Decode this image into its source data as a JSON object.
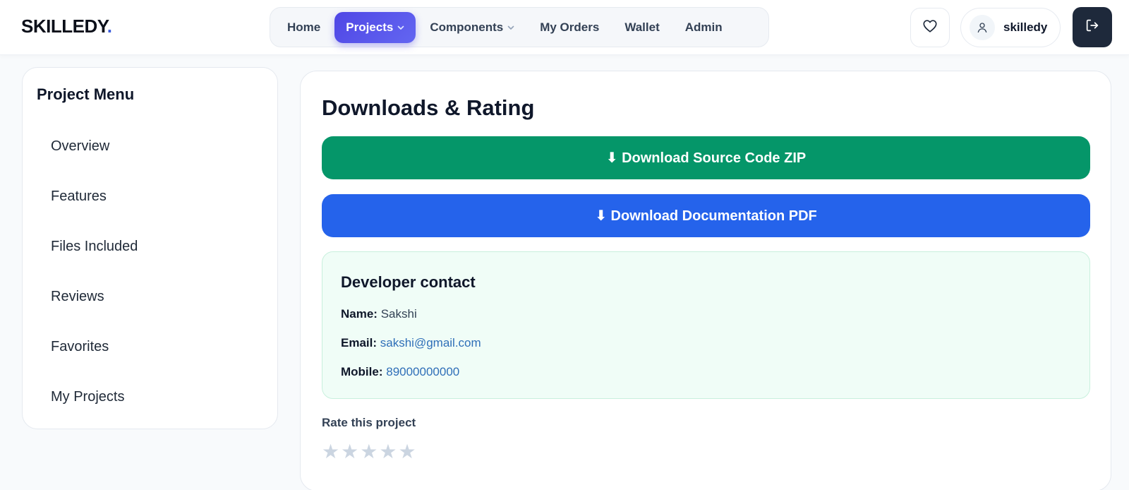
{
  "header": {
    "logo_text": "SKILLEDY",
    "logo_dot": ".",
    "nav": [
      {
        "label": "Home"
      },
      {
        "label": "Projects"
      },
      {
        "label": "Components"
      },
      {
        "label": "My Orders"
      },
      {
        "label": "Wallet"
      },
      {
        "label": "Admin"
      }
    ],
    "user_name": "skilledy"
  },
  "sidebar": {
    "title": "Project Menu",
    "items": [
      {
        "label": "Overview"
      },
      {
        "label": "Features"
      },
      {
        "label": "Files Included"
      },
      {
        "label": "Reviews"
      },
      {
        "label": "Favorites"
      },
      {
        "label": "My Projects"
      }
    ]
  },
  "main": {
    "title": "Downloads & Rating",
    "download_zip_label": "⬇ Download Source Code ZIP",
    "download_pdf_label": "⬇ Download Documentation PDF",
    "contact": {
      "title": "Developer contact",
      "name_label": "Name:",
      "name_value": "Sakshi",
      "email_label": "Email:",
      "email_value": "sakshi@gmail.com",
      "mobile_label": "Mobile:",
      "mobile_value": "89000000000"
    },
    "rate_label": "Rate this project",
    "rating": {
      "value": 0,
      "max": 5
    }
  },
  "colors": {
    "active_nav": "#4f46e5",
    "download_zip": "#059669",
    "download_pdf": "#2563eb",
    "contact_bg": "#f0fdf7",
    "link": "#2f6fb8",
    "star_empty": "#cbd5e1",
    "logo_dot": "#3b5bdb"
  }
}
